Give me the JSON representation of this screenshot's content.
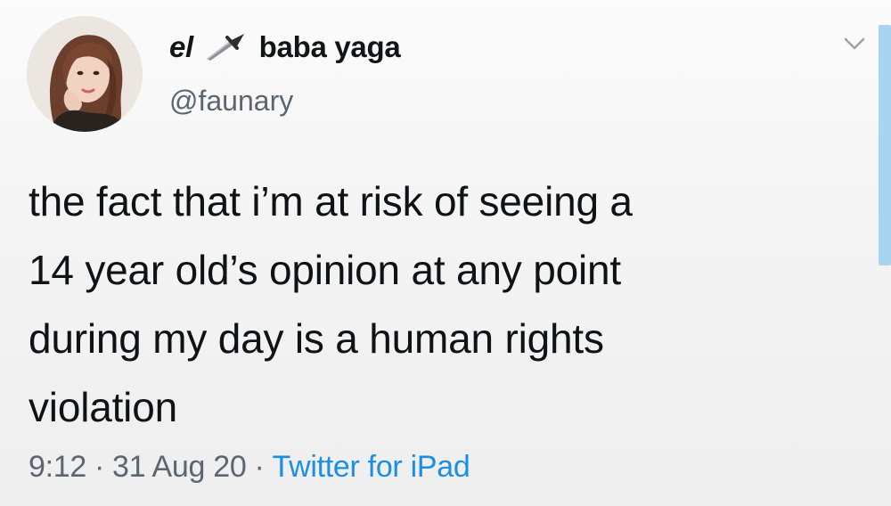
{
  "tweet": {
    "author": {
      "name_prefix": "el",
      "name_emoji": "dagger-icon",
      "name_suffix": "baba yaga",
      "handle": "@faunary"
    },
    "text_lines": [
      "the fact that i’m at risk of seeing a",
      "14 year old’s opinion at any point",
      "during my day is a human rights",
      "violation"
    ],
    "time": "9:12",
    "separator": "·",
    "date": "31 Aug 20",
    "source": "Twitter for iPad",
    "menu_icon": "chevron-down-icon"
  },
  "colors": {
    "background": "#f4f4f4",
    "text": "#101214",
    "secondary_text": "#5b6670",
    "link": "#1d8fe0",
    "scroll_indicator": "#a9d4ef"
  }
}
